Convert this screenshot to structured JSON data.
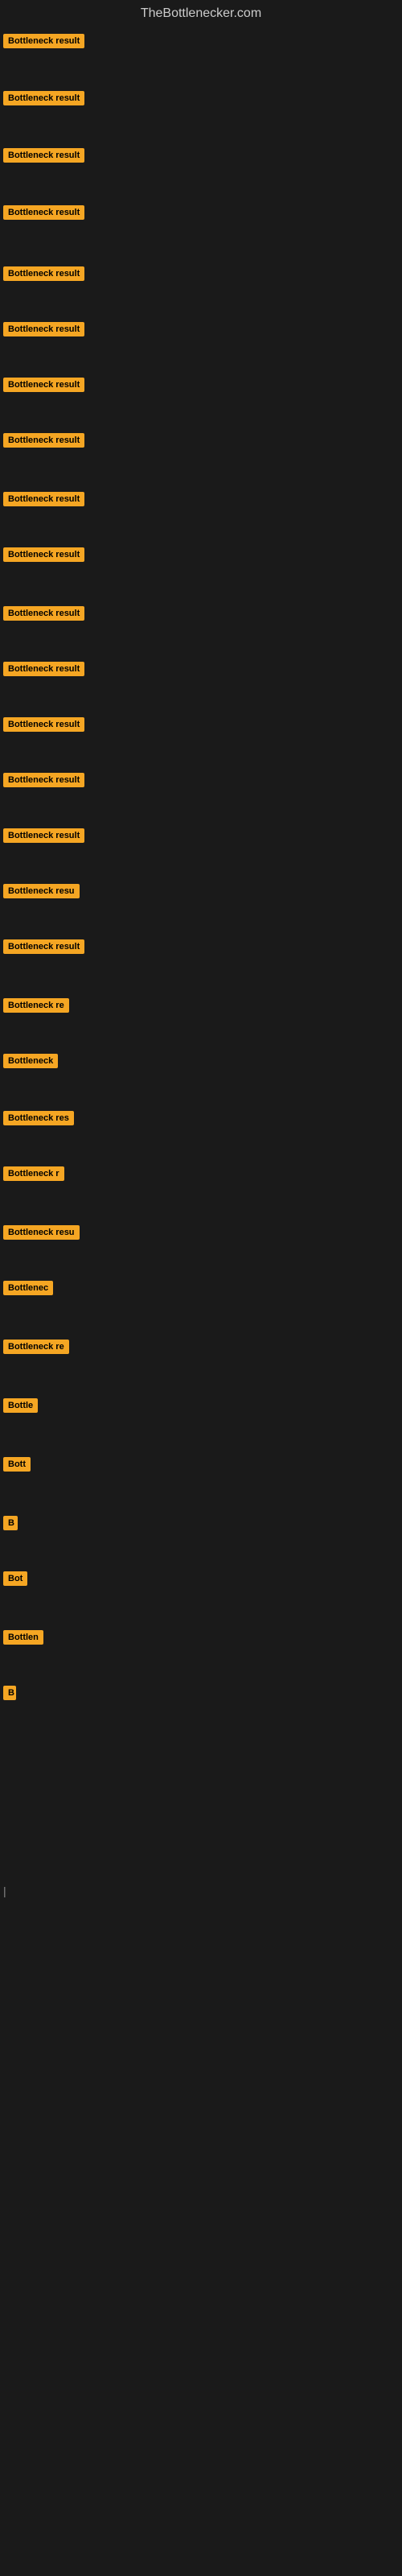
{
  "site": {
    "title": "TheBottlenecker.com"
  },
  "items": [
    {
      "label": "Bottleneck result",
      "width": 130,
      "margin_top": 8
    },
    {
      "label": "Bottleneck result",
      "width": 130,
      "margin_top": 40
    },
    {
      "label": "Bottleneck result",
      "width": 130,
      "margin_top": 40
    },
    {
      "label": "Bottleneck result",
      "width": 128,
      "margin_top": 40
    },
    {
      "label": "Bottleneck result",
      "width": 130,
      "margin_top": 45
    },
    {
      "label": "Bottleneck result",
      "width": 128,
      "margin_top": 38
    },
    {
      "label": "Bottleneck result",
      "width": 128,
      "margin_top": 38
    },
    {
      "label": "Bottleneck result",
      "width": 128,
      "margin_top": 38
    },
    {
      "label": "Bottleneck result",
      "width": 130,
      "margin_top": 42
    },
    {
      "label": "Bottleneck result",
      "width": 128,
      "margin_top": 38
    },
    {
      "label": "Bottleneck result",
      "width": 130,
      "margin_top": 42
    },
    {
      "label": "Bottleneck result",
      "width": 125,
      "margin_top": 38
    },
    {
      "label": "Bottleneck result",
      "width": 128,
      "margin_top": 38
    },
    {
      "label": "Bottleneck result",
      "width": 128,
      "margin_top": 38
    },
    {
      "label": "Bottleneck result",
      "width": 128,
      "margin_top": 38
    },
    {
      "label": "Bottleneck resu",
      "width": 110,
      "margin_top": 38
    },
    {
      "label": "Bottleneck result",
      "width": 128,
      "margin_top": 38
    },
    {
      "label": "Bottleneck re",
      "width": 100,
      "margin_top": 42
    },
    {
      "label": "Bottleneck",
      "width": 82,
      "margin_top": 38
    },
    {
      "label": "Bottleneck res",
      "width": 105,
      "margin_top": 40
    },
    {
      "label": "Bottleneck r",
      "width": 92,
      "margin_top": 38
    },
    {
      "label": "Bottleneck resu",
      "width": 110,
      "margin_top": 42
    },
    {
      "label": "Bottlenec",
      "width": 76,
      "margin_top": 38
    },
    {
      "label": "Bottleneck re",
      "width": 100,
      "margin_top": 42
    },
    {
      "label": "Bottle",
      "width": 54,
      "margin_top": 42
    },
    {
      "label": "Bott",
      "width": 42,
      "margin_top": 42
    },
    {
      "label": "B",
      "width": 18,
      "margin_top": 42
    },
    {
      "label": "Bot",
      "width": 32,
      "margin_top": 38
    },
    {
      "label": "Bottlen",
      "width": 60,
      "margin_top": 42
    },
    {
      "label": "B",
      "width": 16,
      "margin_top": 38
    },
    {
      "label": "",
      "width": 0,
      "margin_top": 80
    },
    {
      "label": "",
      "width": 0,
      "margin_top": 60
    },
    {
      "label": "|",
      "width": 10,
      "margin_top": 60
    },
    {
      "label": "",
      "width": 0,
      "margin_top": 80
    },
    {
      "label": "",
      "width": 0,
      "margin_top": 60
    },
    {
      "label": "",
      "width": 0,
      "margin_top": 60
    }
  ]
}
